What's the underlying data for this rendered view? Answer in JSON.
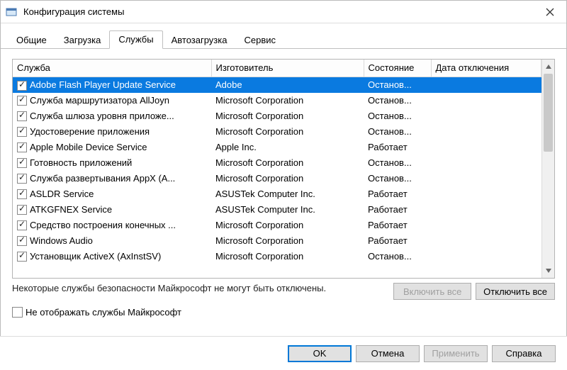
{
  "window": {
    "title": "Конфигурация системы"
  },
  "tabs": {
    "general": "Общие",
    "boot": "Загрузка",
    "services": "Службы",
    "startup": "Автозагрузка",
    "tools": "Сервис"
  },
  "columns": {
    "service": "Служба",
    "manufacturer": "Изготовитель",
    "status": "Состояние",
    "date_disabled": "Дата отключения"
  },
  "services": [
    {
      "checked": true,
      "selected": true,
      "name": "Adobe Flash Player Update Service",
      "mfr": "Adobe",
      "status": "Останов..."
    },
    {
      "checked": true,
      "selected": false,
      "name": "Служба маршрутизатора AllJoyn",
      "mfr": "Microsoft Corporation",
      "status": "Останов..."
    },
    {
      "checked": true,
      "selected": false,
      "name": "Служба шлюза уровня приложе...",
      "mfr": "Microsoft Corporation",
      "status": "Останов..."
    },
    {
      "checked": true,
      "selected": false,
      "name": "Удостоверение приложения",
      "mfr": "Microsoft Corporation",
      "status": "Останов..."
    },
    {
      "checked": true,
      "selected": false,
      "name": "Apple Mobile Device Service",
      "mfr": "Apple Inc.",
      "status": "Работает"
    },
    {
      "checked": true,
      "selected": false,
      "name": "Готовность приложений",
      "mfr": "Microsoft Corporation",
      "status": "Останов..."
    },
    {
      "checked": true,
      "selected": false,
      "name": "Служба развертывания AppX (A...",
      "mfr": "Microsoft Corporation",
      "status": "Останов..."
    },
    {
      "checked": true,
      "selected": false,
      "name": "ASLDR Service",
      "mfr": "ASUSTek Computer Inc.",
      "status": "Работает"
    },
    {
      "checked": true,
      "selected": false,
      "name": "ATKGFNEX Service",
      "mfr": "ASUSTek Computer Inc.",
      "status": "Работает"
    },
    {
      "checked": true,
      "selected": false,
      "name": "Средство построения конечных ...",
      "mfr": "Microsoft Corporation",
      "status": "Работает"
    },
    {
      "checked": true,
      "selected": false,
      "name": "Windows Audio",
      "mfr": "Microsoft Corporation",
      "status": "Работает"
    },
    {
      "checked": true,
      "selected": false,
      "name": "Установщик ActiveX (AxInstSV)",
      "mfr": "Microsoft Corporation",
      "status": "Останов..."
    }
  ],
  "note": "Некоторые службы безопасности Майкрософт не могут быть отключены.",
  "buttons": {
    "enable_all": "Включить все",
    "disable_all": "Отключить все",
    "hide_ms": "Не отображать службы Майкрософт",
    "ok": "OK",
    "cancel": "Отмена",
    "apply": "Применить",
    "help": "Справка"
  }
}
